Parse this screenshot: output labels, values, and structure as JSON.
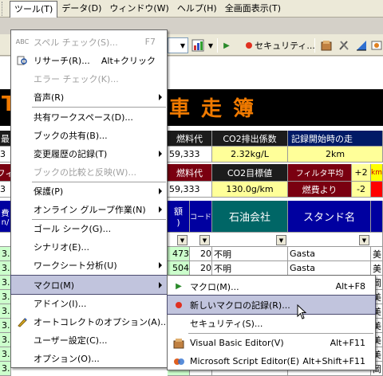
{
  "menubar": {
    "items": [
      "ツール(T)",
      "データ(D)",
      "ウィンドウ(W)",
      "ヘルプ(H)",
      "全画面表示(T)"
    ]
  },
  "toolbar": {
    "security_label": "セキュリティ..."
  },
  "sheet": {
    "banner_chars": [
      "T",
      "車",
      "走",
      "簿"
    ],
    "row1": {
      "c0": "最",
      "fuel_cost_label": "燃料代",
      "co2_factor_label": "CO2排出係数",
      "record_start_label": "記録開始時の走"
    },
    "row2": {
      "c0": "3",
      "fuel_cost_value": "59,333",
      "co2_factor_value": "2.32kg/L",
      "record_start_value": "2km"
    },
    "row3": {
      "c0": "フィ",
      "fuel_cost2_label": "燃料代",
      "co2_target_label": "CO2目標値",
      "filter_avg_label": "フィルタ平均",
      "filter_avg_label2": "燃費より",
      "plus_value": "+2",
      "minus_value": "-2",
      "km_label": "km"
    },
    "row4": {
      "c0": "3",
      "fuel_cost2_value": "59,333",
      "co2_target_value": "130.0g/km"
    },
    "header": {
      "c0": "費",
      "c0b": "n/",
      "amount": "額",
      "amount_b": ")",
      "code": "コード",
      "oil_company": "石油会社",
      "stand_name": "スタンド名"
    },
    "data_rows": [
      {
        "a": "3.",
        "b": "473",
        "code": "20",
        "company": "不明",
        "stand": "Gasta",
        "tail": "美"
      },
      {
        "a": "3.",
        "b": "504",
        "code": "20",
        "company": "不明",
        "stand": "Gasta",
        "tail": "美"
      },
      {
        "a": "3.",
        "b": "",
        "code": "",
        "company": "",
        "stand": "",
        "tail": "岡"
      },
      {
        "a": "3.",
        "b": "",
        "code": "",
        "company": "",
        "stand": "",
        "tail": "美"
      },
      {
        "a": "3.",
        "b": "",
        "code": "",
        "company": "",
        "stand": "",
        "tail": "美"
      },
      {
        "a": "3.",
        "b": "",
        "code": "",
        "company": "",
        "stand": "",
        "tail": "美"
      },
      {
        "a": "3.",
        "b": "",
        "code": "",
        "company": "",
        "stand": "",
        "tail": "美"
      },
      {
        "a": "3.",
        "b": "",
        "code": "",
        "company": "",
        "stand": "",
        "tail": "美"
      },
      {
        "a": "3.",
        "b": "",
        "code": "",
        "company": "",
        "stand": "",
        "tail": "岡"
      }
    ]
  },
  "tools_menu": {
    "items": [
      {
        "label": "スペル チェック(S)...",
        "shortcut": "F7",
        "disabled": true,
        "icon": "spell-check-icon"
      },
      {
        "label": "リサーチ(R)...",
        "shortcut": "Alt+クリック",
        "disabled": false,
        "icon": "research-icon"
      },
      {
        "label": "エラー チェック(K)...",
        "shortcut": "",
        "disabled": true,
        "icon": ""
      },
      {
        "label": "音声(R)",
        "shortcut": "",
        "disabled": false,
        "icon": "",
        "submenu": true
      },
      {
        "label": "共有ワークスペース(D)...",
        "shortcut": "",
        "disabled": false,
        "icon": ""
      },
      {
        "label": "ブックの共有(B)...",
        "shortcut": "",
        "disabled": false,
        "icon": ""
      },
      {
        "label": "変更履歴の記録(T)",
        "shortcut": "",
        "disabled": false,
        "icon": "",
        "submenu": true
      },
      {
        "label": "ブックの比較と反映(W)...",
        "shortcut": "",
        "disabled": true,
        "icon": ""
      },
      {
        "label": "保護(P)",
        "shortcut": "",
        "disabled": false,
        "icon": "",
        "submenu": true
      },
      {
        "label": "オンライン グループ作業(N)",
        "shortcut": "",
        "disabled": false,
        "icon": "",
        "submenu": true
      },
      {
        "label": "ゴール シーク(G)...",
        "shortcut": "",
        "disabled": false,
        "icon": ""
      },
      {
        "label": "シナリオ(E)...",
        "shortcut": "",
        "disabled": false,
        "icon": ""
      },
      {
        "label": "ワークシート分析(U)",
        "shortcut": "",
        "disabled": false,
        "icon": "",
        "submenu": true
      },
      {
        "label": "マクロ(M)",
        "shortcut": "",
        "disabled": false,
        "icon": "",
        "submenu": true,
        "selected": true
      },
      {
        "label": "アドイン(I)...",
        "shortcut": "",
        "disabled": false,
        "icon": ""
      },
      {
        "label": "オートコレクトのオプション(A)...",
        "shortcut": "",
        "disabled": false,
        "icon": "autocorrect-icon"
      },
      {
        "label": "ユーザー設定(C)...",
        "shortcut": "",
        "disabled": false,
        "icon": ""
      },
      {
        "label": "オプション(O)...",
        "shortcut": "",
        "disabled": false,
        "icon": ""
      }
    ]
  },
  "macro_menu": {
    "items": [
      {
        "label": "マクロ(M)...",
        "shortcut": "Alt+F8",
        "icon": "run-macro-icon"
      },
      {
        "label": "新しいマクロの記録(R)...",
        "shortcut": "",
        "icon": "record-macro-icon",
        "selected": true
      },
      {
        "label": "セキュリティ(S)...",
        "shortcut": "",
        "icon": ""
      },
      {
        "label": "Visual Basic Editor(V)",
        "shortcut": "Alt+F11",
        "icon": "vb-editor-icon"
      },
      {
        "label": "Microsoft Script Editor(E)",
        "shortcut": "Alt+Shift+F11",
        "icon": "script-editor-icon"
      }
    ]
  },
  "colors": {
    "banner_orange": "#f07a00",
    "selected_bg": "#c1c4dd"
  }
}
